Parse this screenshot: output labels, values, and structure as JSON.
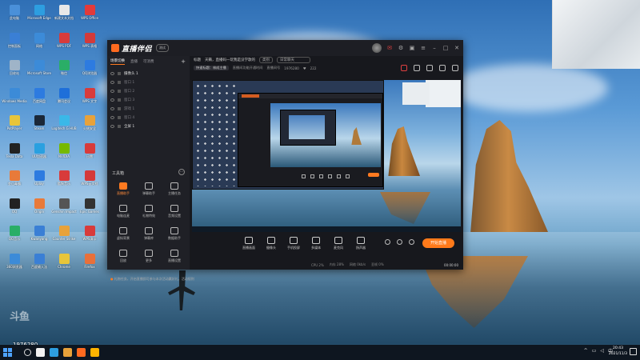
{
  "desktop": {
    "icons": [
      {
        "label": "此电脑",
        "color": "#4a90d9"
      },
      {
        "label": "Microsoft Edge",
        "color": "#2d9ee0"
      },
      {
        "label": "新建文本文档",
        "color": "#e8e8e8"
      },
      {
        "label": "WPS Office",
        "color": "#e23a3a"
      },
      {
        "label": "控制面板",
        "color": "#3a7fd5"
      },
      {
        "label": "网络",
        "color": "#3c8bd8"
      },
      {
        "label": "WPS PDF",
        "color": "#d83b3b"
      },
      {
        "label": "WPS 表格",
        "color": "#d43a3a"
      },
      {
        "label": "回收站",
        "color": "#9fb4c8"
      },
      {
        "label": "Microsoft Store",
        "color": "#3c8bd8"
      },
      {
        "label": "微信",
        "color": "#2aae67"
      },
      {
        "label": "QQ浏览器",
        "color": "#2d7be0"
      },
      {
        "label": "Windows Media",
        "color": "#3c8bd8"
      },
      {
        "label": "百度网盘",
        "color": "#2d7be0"
      },
      {
        "label": "腾讯会议",
        "color": "#1e6fd9"
      },
      {
        "label": "WPS 文字",
        "color": "#d83b3b"
      },
      {
        "label": "PotPlayer",
        "color": "#e8c53a"
      },
      {
        "label": "Steam",
        "color": "#1b2838"
      },
      {
        "label": "Logitech G HUB",
        "color": "#3ab8e8"
      },
      {
        "label": "火绒安全",
        "color": "#e8a23a"
      },
      {
        "label": "Tesla Data",
        "color": "#222"
      },
      {
        "label": "UU加速器",
        "color": "#2aa0e0"
      },
      {
        "label": "NVIDIA",
        "color": "#76b900"
      },
      {
        "label": "迅雷",
        "color": "#d83b3b"
      },
      {
        "label": "金山毒霸",
        "color": "#e87a3a"
      },
      {
        "label": "Uplay",
        "color": "#2d7be0"
      },
      {
        "label": "酷狗音乐",
        "color": "#d83b3b"
      },
      {
        "label": "WPS云文档",
        "color": "#d43a3a"
      },
      {
        "label": "QQ",
        "color": "#222"
      },
      {
        "label": "Origin",
        "color": "#e87a3a"
      },
      {
        "label": "Genshin Impact",
        "color": "#555"
      },
      {
        "label": "Epic Games",
        "color": "#333"
      },
      {
        "label": "QQ音乐",
        "color": "#2aae67"
      },
      {
        "label": "Kwanyang",
        "color": "#3a7fd5"
      },
      {
        "label": "Counter Strike",
        "color": "#e8a23a"
      },
      {
        "label": "WPS演示",
        "color": "#d83b3b"
      },
      {
        "label": "360浏览器",
        "color": "#3c8bd8"
      },
      {
        "label": "百度输入法",
        "color": "#3a7fd5"
      },
      {
        "label": "Chrome",
        "color": "#e8c53a"
      },
      {
        "label": "Firefox",
        "color": "#e8703a"
      }
    ],
    "watermark_id": "1976280"
  },
  "app": {
    "logo_text": "直播伴侣",
    "version_label": "测试",
    "tabs": [
      "场景切换",
      "直播",
      "可消费"
    ],
    "add_tab": "+",
    "scenes": [
      "摄像头 1",
      "窗口 1",
      "窗口 2",
      "窗口 3",
      "游戏 1",
      "窗口 4",
      "全屏 1"
    ],
    "toolbox_title": "工具箱",
    "tools": [
      {
        "label": "直播助手",
        "highlight": true
      },
      {
        "label": "弹幕助手",
        "highlight": false
      },
      {
        "label": "主播任务",
        "highlight": false
      },
      {
        "label": "电脑连麦",
        "highlight": false
      },
      {
        "label": "礼物特效",
        "highlight": false
      },
      {
        "label": "音频设置",
        "highlight": false
      },
      {
        "label": "虚拟背景",
        "highlight": false
      },
      {
        "label": "弹幕库",
        "highlight": false
      },
      {
        "label": "数据助手",
        "highlight": false
      },
      {
        "label": "回放",
        "highlight": false
      },
      {
        "label": "更多",
        "highlight": false
      },
      {
        "label": "直播设置",
        "highlight": false
      }
    ],
    "notice_text": "礼物任务，开启直播即可参与本次活动赢好礼，活动规则",
    "info_title_label": "标题",
    "info_title": "天籁，直播码一玩我是没学歌的",
    "info_category_label": "类别",
    "info_category": "日常聊天",
    "info_room_label": "直播间号",
    "info_room": "1976280",
    "info_fans": "222",
    "info_tag1": "快速标题：林成主播",
    "info_tag2": "直播间功能开通时间",
    "controls": [
      "直播画面",
      "摄像头",
      "手机投屏",
      "多媒体",
      "麦克风",
      "扬声器"
    ],
    "go_live": "开始直播",
    "status": [
      "CPU 2%",
      "内存 28%",
      "网络 0kb/s",
      "丢帧 0%"
    ],
    "timer": "00:00:00"
  },
  "taskbar": {
    "time": "20:43",
    "date": "2021/11/3",
    "apps": [
      "#f2f2f2",
      "#2d9ee0",
      "#e8a23a",
      "#ff6a1f",
      "#ffb400"
    ]
  },
  "colors": {
    "accent": "#ff7a1a",
    "window_bg": "#17181d",
    "panel_bg": "#1f2026"
  }
}
